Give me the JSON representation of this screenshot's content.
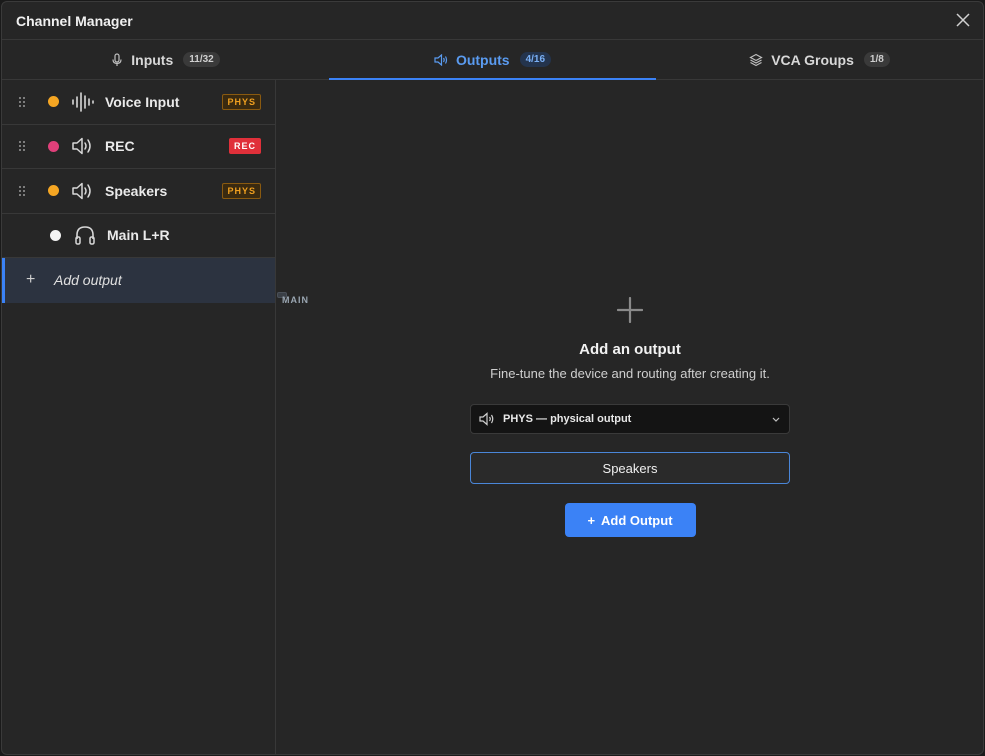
{
  "window": {
    "title": "Channel Manager"
  },
  "tabs": [
    {
      "label": "Inputs",
      "count": "11/32",
      "icon": "mic-icon"
    },
    {
      "label": "Outputs",
      "count": "4/16",
      "icon": "speaker-icon"
    },
    {
      "label": "VCA Groups",
      "count": "1/8",
      "icon": "layers-icon"
    }
  ],
  "active_tab": "Outputs",
  "outputs": [
    {
      "label": "Voice Input",
      "tag": "PHYS",
      "dot_color": "#f5a623",
      "icon": "waveform-icon"
    },
    {
      "label": "REC",
      "tag": "REC",
      "dot_color": "#e0407a",
      "icon": "speaker-icon"
    },
    {
      "label": "Speakers",
      "tag": "PHYS",
      "dot_color": "#f5a623",
      "icon": "speaker-icon"
    },
    {
      "label": "Main L+R",
      "tag": "MAIN",
      "dot_color": "#f2f2f2",
      "icon": "headphones-icon"
    }
  ],
  "sidebar": {
    "add_label": "Add output",
    "add_symbol": "+"
  },
  "empty_state": {
    "heading": "Add an output",
    "subtext": "Fine-tune the device and routing after creating it.",
    "type_select": "PHYS — physical output",
    "name_value": "Speakers",
    "button_label": "Add Output",
    "button_symbol": "+"
  },
  "colors": {
    "accent": "#3b82f6",
    "background": "#262626"
  }
}
